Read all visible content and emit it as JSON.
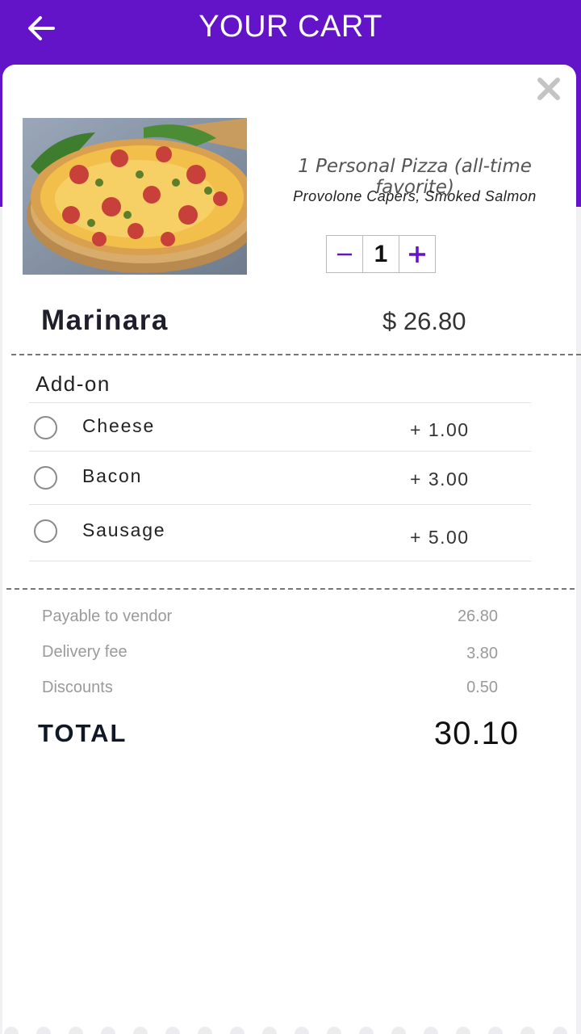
{
  "header": {
    "title": "YOUR CART",
    "back_icon": "arrow-left-icon",
    "background": "#6314c8"
  },
  "item": {
    "name": "1 Personal Pizza (all-time favorite)",
    "description": "Provolone Capers, Smoked Salmon",
    "quantity": "1",
    "decrement_label": "−",
    "increment_label": "+",
    "close_icon": "close-icon"
  },
  "product": {
    "title": "Marinara",
    "price": "$ 26.80"
  },
  "addons": {
    "heading": "Add-on",
    "items": [
      {
        "label": "Cheese",
        "price": "+ 1.00",
        "selected": false
      },
      {
        "label": "Bacon",
        "price": "+ 3.00",
        "selected": false
      },
      {
        "label": "Sausage",
        "price": "+ 5.00",
        "selected": false
      }
    ]
  },
  "summary": {
    "rows": [
      {
        "label": "Payable to vendor",
        "value": "26.80"
      },
      {
        "label": "Delivery fee",
        "value": "3.80"
      },
      {
        "label": "Discounts",
        "value": "0.50"
      }
    ],
    "total_label": "TOTAL",
    "total_value": "30.10"
  },
  "colors": {
    "accent": "#6314c8",
    "text_dark": "#1e1e2c",
    "muted": "#9a9a9a"
  }
}
